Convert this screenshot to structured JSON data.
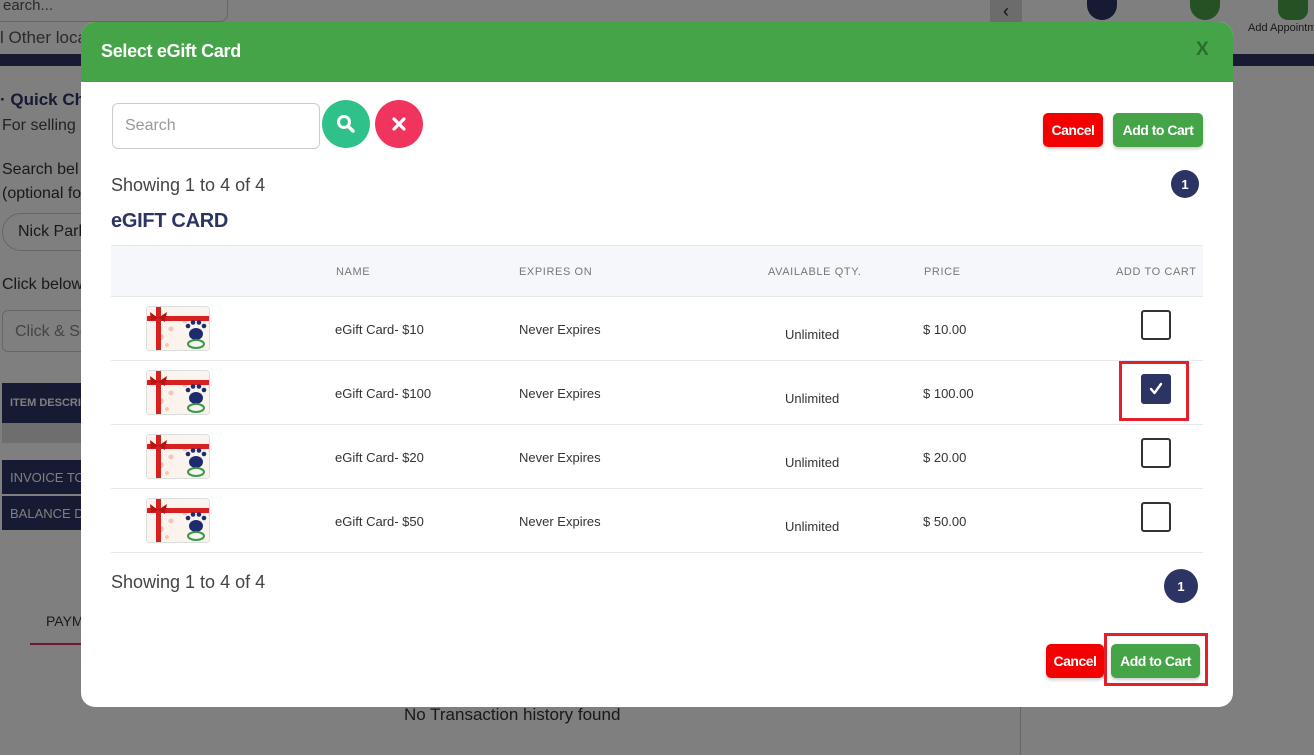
{
  "background": {
    "search_text": "earch...",
    "location_text": "l Other loca",
    "nav_back_glyph": "‹",
    "add_appointment_label": "Add Appointm",
    "quick_title": "·  Quick Ch",
    "selling_text": "For selling",
    "search_below_line1": "Search bel",
    "search_below_line2": "(optional fo",
    "customer_chip": "Nick Park",
    "click_below": "Click below",
    "click_scan_placeholder": "Click & Sc",
    "item_desc_header": "ITEM DESCRI",
    "invoice_total_label": "INVOICE TO",
    "balance_due_label": "BALANCE D",
    "payments_tab": "PAYM",
    "no_transactions": "No Transaction history found"
  },
  "modal": {
    "title": "Select eGift Card",
    "close_label": "X",
    "search": {
      "placeholder": "Search",
      "value": ""
    },
    "cancel_label": "Cancel",
    "add_to_cart_label": "Add to Cart",
    "showing_text": "Showing 1 to 4 of 4",
    "current_page": "1",
    "section_title": "eGIFT CARD",
    "columns": [
      "NAME",
      "EXPIRES ON",
      "AVAILABLE QTY.",
      "PRICE",
      "ADD TO CART"
    ],
    "rows": [
      {
        "name": "eGift Card- $10",
        "expires": "Never Expires",
        "qty": "Unlimited",
        "price": "$ 10.00",
        "checked": false
      },
      {
        "name": "eGift Card- $100",
        "expires": "Never Expires",
        "qty": "Unlimited",
        "price": "$ 100.00",
        "checked": true
      },
      {
        "name": "eGift Card- $20",
        "expires": "Never Expires",
        "qty": "Unlimited",
        "price": "$ 20.00",
        "checked": false
      },
      {
        "name": "eGift Card- $50",
        "expires": "Never Expires",
        "qty": "Unlimited",
        "price": "$ 50.00",
        "checked": false
      }
    ]
  },
  "colors": {
    "header_green": "#45a447",
    "navy": "#2c3464",
    "cancel_red": "#f40000",
    "highlight_red": "#e3202a",
    "search_green": "#2ec28a",
    "clear_pink": "#f0345e"
  }
}
